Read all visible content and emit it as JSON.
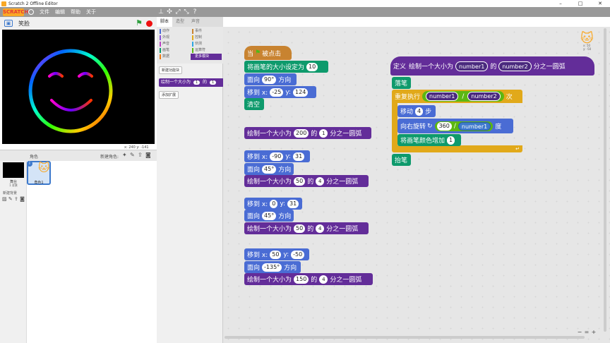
{
  "window": {
    "title": "Scratch 2 Offline Editor",
    "minimize": "–",
    "maximize": "□",
    "close": "✕"
  },
  "menu": {
    "logo": "SCRATCH",
    "items": [
      "文件",
      "编辑",
      "帮助",
      "关于"
    ]
  },
  "stage": {
    "project_title": "笑脸",
    "coords": "x: 240  y: -141"
  },
  "sprites": {
    "header_label": "角色",
    "new_sprite_label": "新建角色:",
    "stage_label": "舞台",
    "stage_backdrops": "1 背景",
    "new_backdrop_label": "新建背景",
    "list": [
      {
        "name": "角色1"
      }
    ]
  },
  "tabs": [
    {
      "label": "脚本",
      "active": true
    },
    {
      "label": "造型",
      "active": false
    },
    {
      "label": "声音",
      "active": false
    }
  ],
  "palette": {
    "categories": [
      {
        "label": "动作",
        "color": "#4a6cd4"
      },
      {
        "label": "事件",
        "color": "#c88330"
      },
      {
        "label": "外观",
        "color": "#8a55d7"
      },
      {
        "label": "控制",
        "color": "#e1a91a"
      },
      {
        "label": "声音",
        "color": "#bb42c3"
      },
      {
        "label": "侦测",
        "color": "#2ca5e2"
      },
      {
        "label": "画笔",
        "color": "#0e9a6c"
      },
      {
        "label": "运算符",
        "color": "#5cb712"
      },
      {
        "label": "数据",
        "color": "#ee7d16"
      },
      {
        "label": "更多模块",
        "color": "#632d99"
      }
    ],
    "make_block_label": "新建功能块",
    "custom_block": {
      "text1": "绘制一个大小为",
      "arg1": "1",
      "text2": "的",
      "arg2": "1"
    },
    "add_extension_label": "添加扩展"
  },
  "scripts": {
    "when_flag": {
      "text1": "当",
      "text2": "被点击"
    },
    "set_pen_size": {
      "text": "将画笔的大小设定为",
      "value": "10"
    },
    "point1": {
      "text1": "面向",
      "value": "90°",
      "text2": "方向"
    },
    "goto1": {
      "text1": "移到 x:",
      "x": "-25",
      "text2": "y:",
      "y": "124"
    },
    "clear": {
      "text": "清空"
    },
    "draw1": {
      "text1": "绘制一个大小为",
      "size": "200",
      "text2": "的",
      "n": "1",
      "text3": "分之一圆弧"
    },
    "goto2": {
      "text1": "移到 x:",
      "x": "-90",
      "text2": "y:",
      "y": "31"
    },
    "point2": {
      "text1": "面向",
      "value": "45°",
      "text2": "方向"
    },
    "draw2": {
      "text1": "绘制一个大小为",
      "size": "50",
      "text2": "的",
      "n": "4",
      "text3": "分之一圆弧"
    },
    "goto3": {
      "text1": "移到 x:",
      "x": "0",
      "text2": "y:",
      "y": "31"
    },
    "point3": {
      "text1": "面向",
      "value": "45°",
      "text2": "方向"
    },
    "draw3": {
      "text1": "绘制一个大小为",
      "size": "50",
      "text2": "的",
      "n": "4",
      "text3": "分之一圆弧"
    },
    "goto4": {
      "text1": "移到 x:",
      "x": "50",
      "text2": "y:",
      "y": "-50"
    },
    "point4": {
      "text1": "面向",
      "value": "-135°",
      "text2": "方向"
    },
    "draw4": {
      "text1": "绘制一个大小为",
      "size": "150",
      "text2": "的",
      "n": "4",
      "text3": "分之一圆弧"
    },
    "define": {
      "text1": "定义",
      "text2": "绘制一个大小为",
      "param1": "number1",
      "text3": "的",
      "param2": "number2",
      "text4": "分之一圆弧"
    },
    "pen_down": {
      "text": "落笔"
    },
    "repeat": {
      "text1": "重复执行",
      "param1": "number1",
      "op": "/",
      "param2": "number2",
      "text2": "次"
    },
    "move": {
      "text1": "移动",
      "value": "4",
      "text2": "步"
    },
    "turn": {
      "text1": "向右旋转",
      "value": "360",
      "op": "/",
      "param": "number1",
      "text2": "度"
    },
    "change_color": {
      "text": "将画笔颜色增加",
      "value": "1"
    },
    "pen_up": {
      "text": "抬笔"
    }
  },
  "sprite_info": {
    "x": "x: 50",
    "y": "y: -50"
  },
  "zoom": {
    "out": "−",
    "reset": "=",
    "in": "+"
  }
}
